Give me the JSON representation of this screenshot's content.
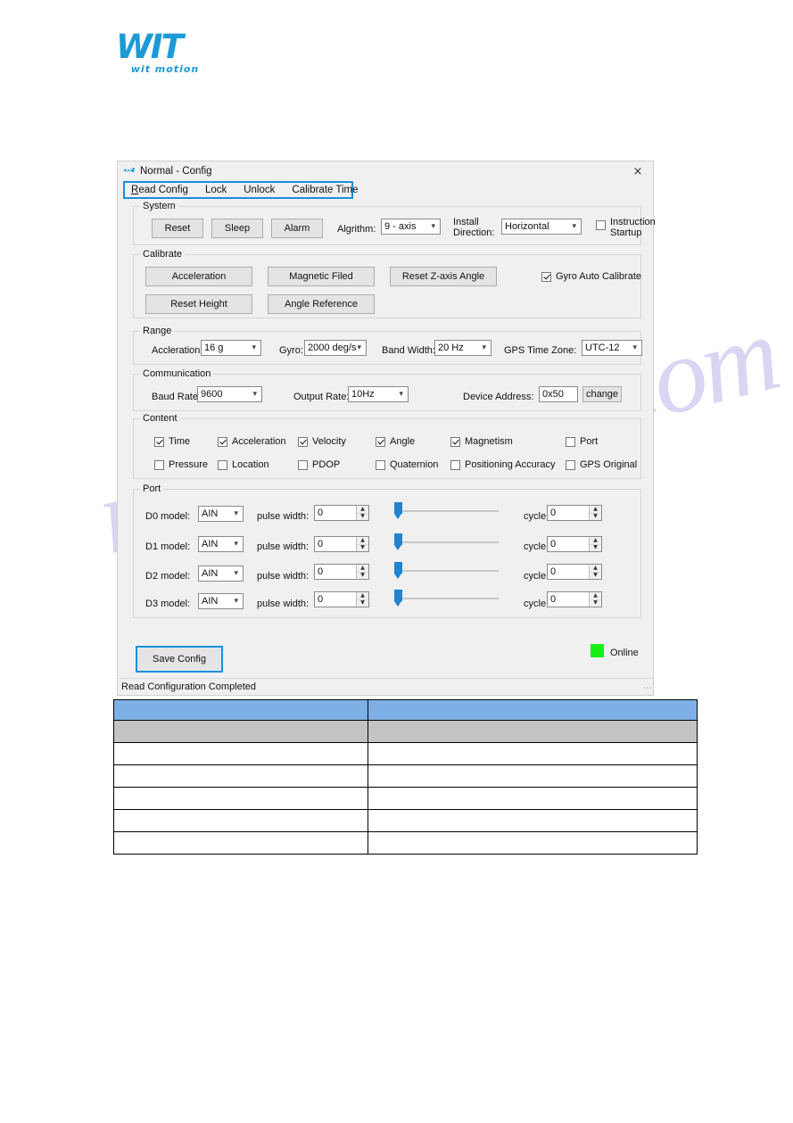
{
  "logo": {
    "main": "WIT",
    "sub": "wit motion"
  },
  "watermark": {
    "text": "manualshive.com"
  },
  "window": {
    "title": "Normal - Config",
    "title_icon": "wit-logo-icon",
    "close_icon": "×",
    "menu": [
      {
        "label": "Read Config",
        "accel": "R"
      },
      {
        "label": "Lock",
        "accel": ""
      },
      {
        "label": "Unlock",
        "accel": ""
      },
      {
        "label": "Calibrate Time",
        "accel": ""
      }
    ]
  },
  "system": {
    "legend": "System",
    "buttons": [
      "Reset",
      "Sleep",
      "Alarm"
    ],
    "algrithm_label": "Algrithm:",
    "algrithm_value": "9 - axis",
    "install_direction_label": "Install\nDirection:",
    "install_direction_label_line1": "Install",
    "install_direction_label_line2": "Direction:",
    "install_direction_value": "Horizontal",
    "instruction_startup_line1": "Instruction",
    "instruction_startup_line2": "Startup",
    "instruction_startup_checked": false
  },
  "calibrate": {
    "legend": "Calibrate",
    "buttons": [
      "Acceleration",
      "Magnetic Filed",
      "Reset Z-axis Angle",
      "Reset Height",
      "Angle Reference"
    ],
    "gyro_auto_label": "Gyro Auto Calibrate",
    "gyro_auto_checked": true
  },
  "range": {
    "legend": "Range",
    "fields": [
      {
        "label": "Accleration:",
        "value": "16 g"
      },
      {
        "label": "Gyro:",
        "value": "2000 deg/s"
      },
      {
        "label": "Band Width:",
        "value": "20   Hz"
      },
      {
        "label": "GPS Time Zone:",
        "value": "UTC-12"
      }
    ]
  },
  "communication": {
    "legend": "Communication",
    "baud_label": "Baud Rate:",
    "baud_value": "9600",
    "output_label": "Output Rate:",
    "output_value": "10Hz",
    "device_label": "Device Address:",
    "device_value": "0x50",
    "change_button": "change"
  },
  "content": {
    "legend": "Content",
    "row1": [
      {
        "label": "Time",
        "checked": true
      },
      {
        "label": "Acceleration",
        "checked": true
      },
      {
        "label": "Velocity",
        "checked": true
      },
      {
        "label": "Angle",
        "checked": true
      },
      {
        "label": "Magnetism",
        "checked": true
      },
      {
        "label": "Port",
        "checked": false
      }
    ],
    "row2": [
      {
        "label": "Pressure",
        "checked": false
      },
      {
        "label": "Location",
        "checked": false
      },
      {
        "label": "PDOP",
        "checked": false
      },
      {
        "label": "Quaternion",
        "checked": false
      },
      {
        "label": "Positioning Accuracy",
        "checked": false
      },
      {
        "label": "GPS Original",
        "checked": false
      }
    ]
  },
  "port": {
    "legend": "Port",
    "pulse_label": "pulse width:",
    "cycle_label": "cycle:",
    "rows": [
      {
        "model_label": "D0 model:",
        "model_value": "AIN",
        "pulse_width": "0",
        "cycle": "0",
        "slider_pos": 0
      },
      {
        "model_label": "D1 model:",
        "model_value": "AIN",
        "pulse_width": "0",
        "cycle": "0",
        "slider_pos": 0
      },
      {
        "model_label": "D2 model:",
        "model_value": "AIN",
        "pulse_width": "0",
        "cycle": "0",
        "slider_pos": 0
      },
      {
        "model_label": "D3 model:",
        "model_value": "AIN",
        "pulse_width": "0",
        "cycle": "0",
        "slider_pos": 0
      }
    ]
  },
  "footer": {
    "save_button": "Save Config",
    "online_label": "Online",
    "online_color": "#16f016",
    "status_text": "Read Configuration Completed"
  },
  "doc_table": {
    "header_blue": [
      "",
      ""
    ],
    "header_gray": [
      "",
      ""
    ],
    "rows": [
      [
        "",
        ""
      ],
      [
        "",
        ""
      ],
      [
        "",
        ""
      ],
      [
        "",
        ""
      ],
      [
        "",
        ""
      ]
    ]
  },
  "colors": {
    "accent_blue": "#1a8fdc",
    "table_header_blue": "#7eb0e5",
    "table_subheader_gray": "#c3c3c3",
    "logo_blue": "#1b9ad6"
  }
}
